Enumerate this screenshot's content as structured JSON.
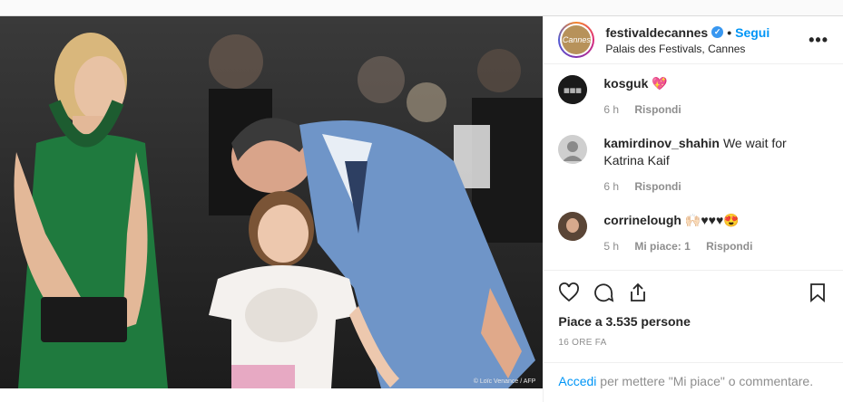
{
  "header": {
    "avatar_logo_text": "Cannes",
    "username": "festivaldecannes",
    "separator": "•",
    "follow_label": "Segui",
    "location": "Palais des Festivals, Cannes",
    "more_label": "•••"
  },
  "photo": {
    "credit": "© Loïc Venance / AFP"
  },
  "comments": [
    {
      "user": "kosguk",
      "text": "💖",
      "time": "6 h",
      "reply": "Rispondi",
      "likes": ""
    },
    {
      "user": "kamirdinov_shahin",
      "text": "We wait for Katrina Kaif",
      "time": "6 h",
      "reply": "Rispondi",
      "likes": ""
    },
    {
      "user": "corrinelough",
      "text": "🙌🏻♥♥♥😍",
      "time": "5 h",
      "reply": "Rispondi",
      "likes": "Mi piace: 1"
    }
  ],
  "actions": {
    "likes_text": "Piace a 3.535 persone",
    "timestamp": "16 ORE FA"
  },
  "login": {
    "link": "Accedi",
    "rest": "per mettere \"Mi piace\" o commentare."
  },
  "colors": {
    "accent": "#0095f6",
    "muted": "#8e8e8e",
    "border": "#efefef"
  }
}
